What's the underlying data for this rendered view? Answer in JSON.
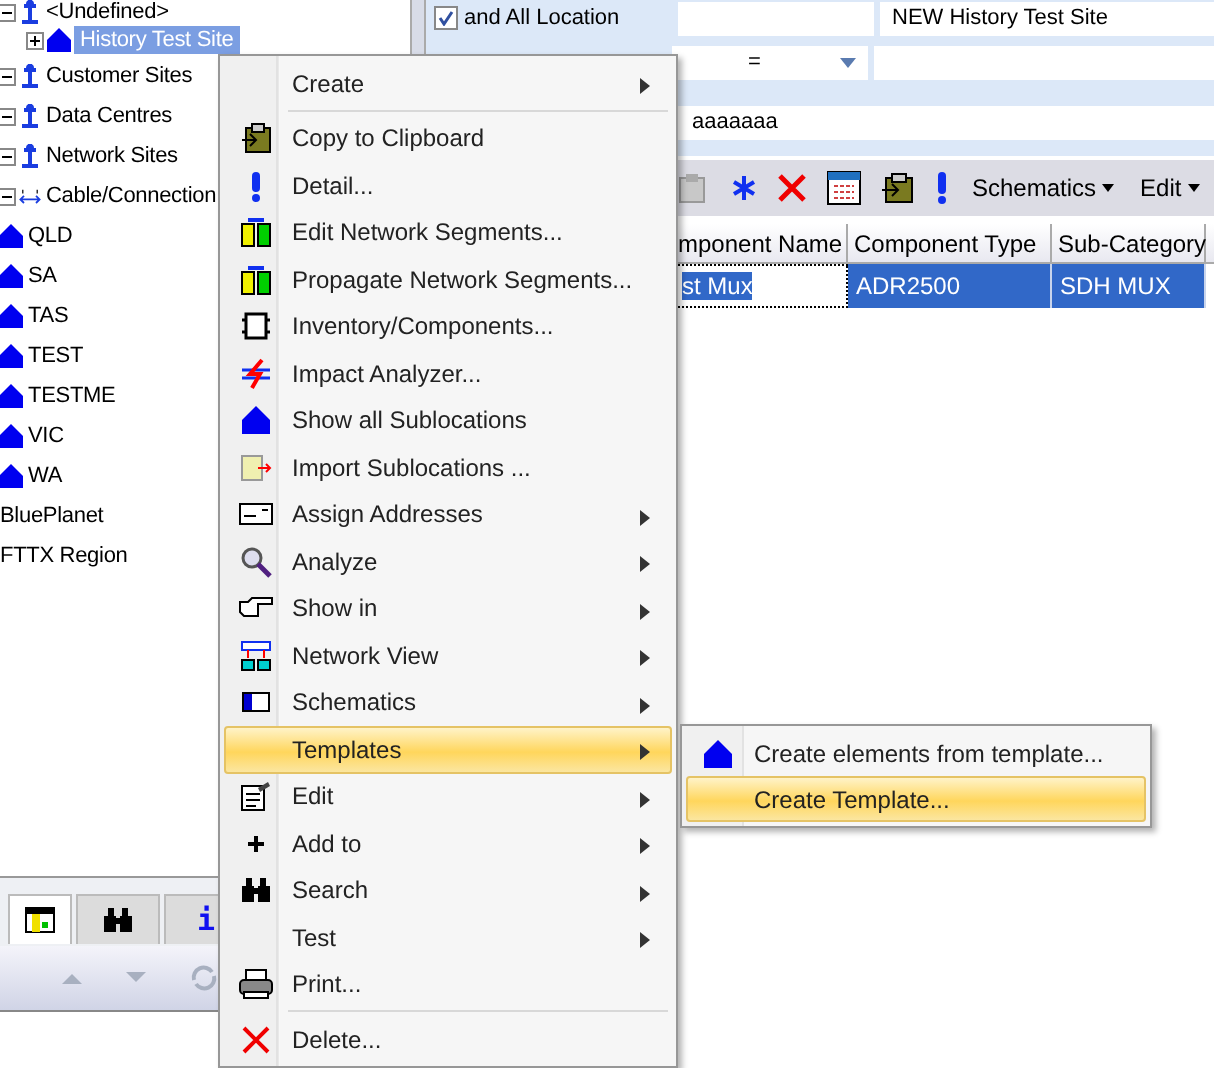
{
  "tree": [
    {
      "label": "<Undefined>",
      "kind": "group",
      "expanded": true,
      "selected": false,
      "children": [
        {
          "label": "History Test Site",
          "kind": "site",
          "expanded": false,
          "selected": true
        }
      ]
    },
    {
      "label": "Customer Sites",
      "kind": "group",
      "expanded": true,
      "selected": false
    },
    {
      "label": "Data Centres",
      "kind": "group",
      "expanded": true,
      "selected": false
    },
    {
      "label": "Network Sites",
      "kind": "group",
      "expanded": true,
      "selected": false
    },
    {
      "label": "Cable/Connection",
      "kind": "cable",
      "expanded": true,
      "selected": false
    },
    {
      "label": "QLD",
      "kind": "site",
      "selected": false
    },
    {
      "label": "SA",
      "kind": "site",
      "selected": false
    },
    {
      "label": "TAS",
      "kind": "site",
      "selected": false
    },
    {
      "label": "TEST",
      "kind": "site",
      "selected": false
    },
    {
      "label": "TESTME",
      "kind": "site",
      "selected": false
    },
    {
      "label": "VIC",
      "kind": "site",
      "selected": false
    },
    {
      "label": "WA",
      "kind": "site",
      "selected": false
    },
    {
      "label": "BluePlanet",
      "kind": "plain",
      "selected": false
    },
    {
      "label": "FTTX Region",
      "kind": "plain",
      "selected": false
    }
  ],
  "bottom_tabs": [
    {
      "selected": true
    },
    {
      "selected": false
    },
    {
      "label": "i",
      "selected": false
    }
  ],
  "filter": {
    "checked": true,
    "checkbox_label": "and All Location",
    "location_value": "NEW History Test Site",
    "operator": "=",
    "search_value": "aaaaaaa"
  },
  "toolbar": [
    "Schematics",
    "Edit"
  ],
  "table": {
    "columns": [
      "mponent Name",
      "Component Type",
      "Sub-Category"
    ],
    "rows": [
      {
        "cells": [
          "st Mux",
          "ADR2500",
          "SDH MUX"
        ],
        "selected": true
      }
    ]
  },
  "menu": {
    "items": [
      {
        "kind": "item",
        "label": "Create",
        "submenu": true,
        "selected": false
      },
      {
        "kind": "separator"
      },
      {
        "kind": "item",
        "label": "Copy to Clipboard",
        "submenu": false,
        "selected": false
      },
      {
        "kind": "item",
        "label": "Detail...",
        "submenu": false,
        "selected": false
      },
      {
        "kind": "item",
        "label": "Edit Network Segments...",
        "submenu": false,
        "selected": false
      },
      {
        "kind": "item",
        "label": "Propagate Network Segments...",
        "submenu": false,
        "selected": false
      },
      {
        "kind": "item",
        "label": "Inventory/Components...",
        "submenu": false,
        "selected": false
      },
      {
        "kind": "item",
        "label": "Impact Analyzer...",
        "submenu": false,
        "selected": false
      },
      {
        "kind": "item",
        "label": "Show all Sublocations",
        "submenu": false,
        "selected": false
      },
      {
        "kind": "item",
        "label": "Import Sublocations ...",
        "submenu": false,
        "selected": false
      },
      {
        "kind": "item",
        "label": "Assign Addresses",
        "submenu": true,
        "selected": false
      },
      {
        "kind": "item",
        "label": "Analyze",
        "submenu": true,
        "selected": false
      },
      {
        "kind": "item",
        "label": "Show in",
        "submenu": true,
        "selected": false
      },
      {
        "kind": "item",
        "label": "Network View",
        "submenu": true,
        "selected": false
      },
      {
        "kind": "item",
        "label": "Schematics",
        "submenu": true,
        "selected": false
      },
      {
        "kind": "item",
        "label": "Templates",
        "submenu": true,
        "selected": true
      },
      {
        "kind": "item",
        "label": "Edit",
        "submenu": true,
        "selected": false
      },
      {
        "kind": "item",
        "label": "Add to",
        "submenu": true,
        "selected": false
      },
      {
        "kind": "item",
        "label": "Search",
        "submenu": true,
        "selected": false
      },
      {
        "kind": "item",
        "label": "Test",
        "submenu": true,
        "selected": false
      },
      {
        "kind": "item",
        "label": "Print...",
        "submenu": false,
        "selected": false
      },
      {
        "kind": "separator"
      },
      {
        "kind": "item",
        "label": "Delete...",
        "submenu": false,
        "selected": false
      }
    ]
  },
  "submenu": {
    "items": [
      {
        "label": "Create elements from template...",
        "selected": false
      },
      {
        "label": "Create Template...",
        "selected": true
      }
    ]
  }
}
